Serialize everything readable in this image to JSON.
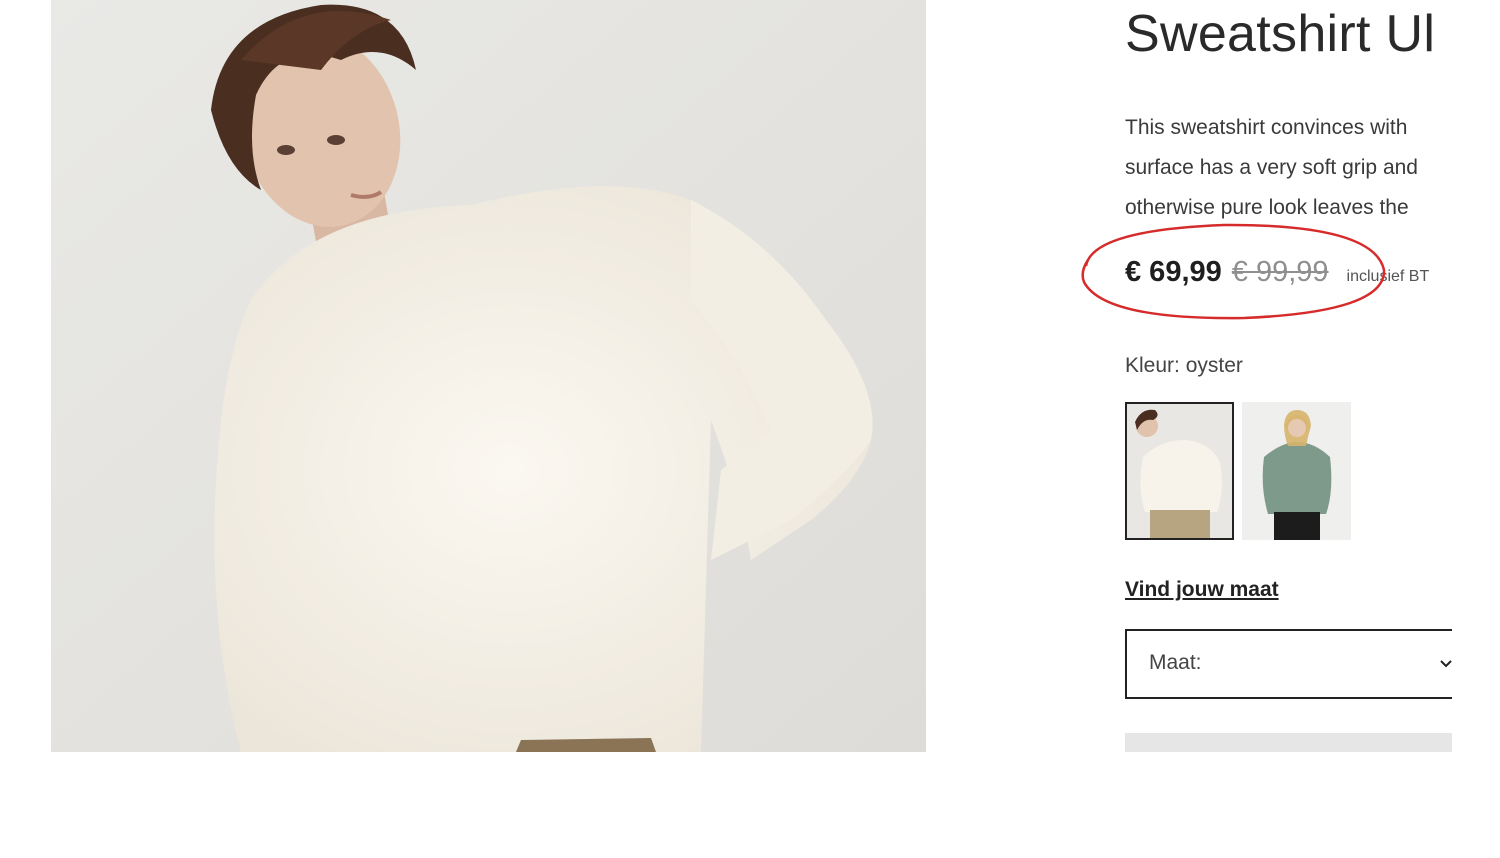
{
  "product": {
    "title": "Sweatshirt Ul",
    "description_lines": [
      "This sweatshirt convinces with",
      "surface has a very soft grip and",
      "otherwise pure look leaves the"
    ],
    "price_current": "€ 69,99",
    "price_old": "€ 99,99",
    "vat_note": "inclusief BT",
    "color_label": "Kleur: oyster",
    "size_link": "Vind jouw maat",
    "size_select_label": "Maat:"
  },
  "colors": {
    "annotation": "#d62b2b",
    "text": "#222222",
    "old_price": "#8f8f8f"
  },
  "swatches": [
    {
      "name": "oyster",
      "selected": true
    },
    {
      "name": "sage green",
      "selected": false
    }
  ],
  "icons": {
    "select_chevron": "chevron-down-icon",
    "annotation": "red-ellipse"
  }
}
